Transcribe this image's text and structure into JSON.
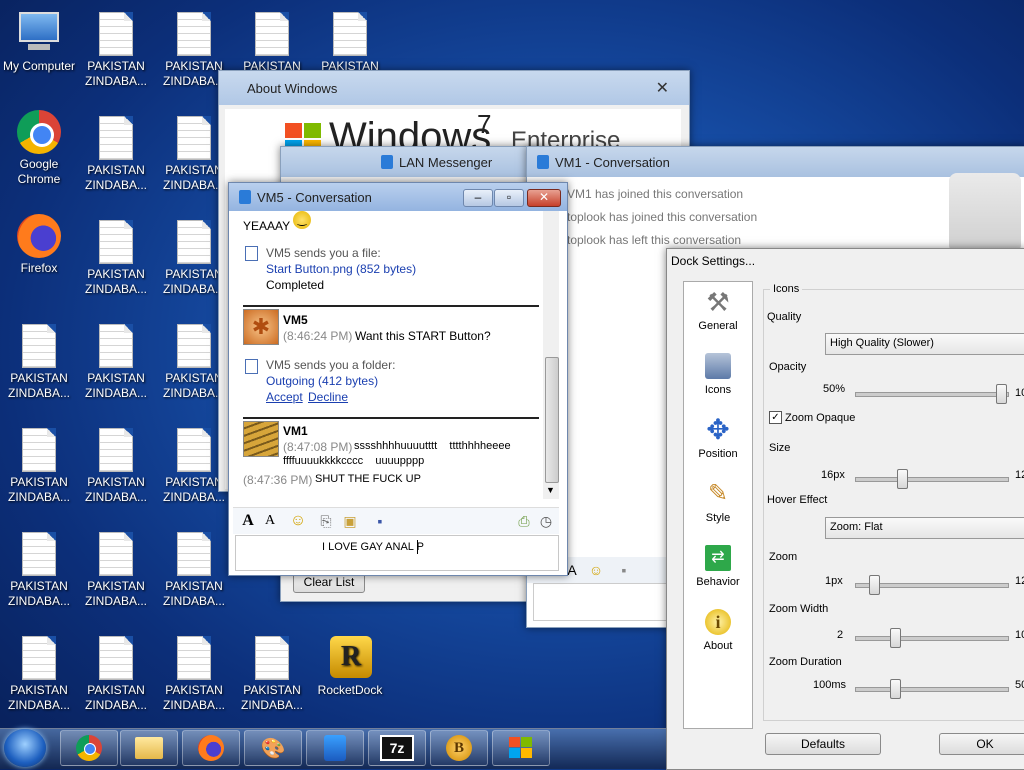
{
  "desktop": {
    "my_computer": "My Computer",
    "chrome": "Google Chrome",
    "firefox": "Firefox",
    "rocketdock": "RocketDock",
    "pak_line1": "PAKISTAN",
    "pak_line2": "ZINDABA...",
    "pak_name_visible": "PAKISTAN"
  },
  "about_windows": {
    "title": "About Windows",
    "logo_text": "Windows",
    "logo_seven": "7",
    "edition": "Enterprise"
  },
  "lan_messenger": {
    "title": "LAN Messenger",
    "clear_list": "Clear List"
  },
  "vm1_conv": {
    "title": "VM1 - Conversation",
    "lines": [
      "VM1 has joined this conversation",
      "toplook has joined this conversation",
      "toplook has left this conversation"
    ]
  },
  "vm5_conv": {
    "title": "VM5 - Conversation",
    "msg_yeaaay": "YEAAAY",
    "file_send": "VM5 sends you a file:",
    "file_name": "Start Button.png (852 bytes)",
    "file_status": "Completed",
    "vm5_name": "VM5",
    "vm5_time": "(8:46:24 PM)",
    "vm5_text": "Want this START Button?",
    "folder_send": "VM5 sends you a folder:",
    "folder_name": "Outgoing (412 bytes)",
    "accept": "Accept",
    "decline": "Decline",
    "vm1_name": "VM1",
    "vm1_time": "(8:47:08 PM)",
    "vm1_text1": "sssshhhhuuuutttt    tttthhhheeee",
    "vm1_text2": "ffffuuuukkkkcccc    uuuupppp",
    "vm1_time2": "(8:47:36 PM)",
    "vm1_text3": "SHUT THE FUCK UP",
    "input_value": "I LOVE GAY ANAL P"
  },
  "dock_settings": {
    "title": "Dock Settings...",
    "nav": [
      "General",
      "Icons",
      "Position",
      "Style",
      "Behavior",
      "About"
    ],
    "group_title": "Icons",
    "quality_label": "Quality",
    "quality_value": "High Quality (Slower)",
    "opacity_label": "Opacity",
    "opacity_value": "50%",
    "opacity_max": "10",
    "opacity_level": 1.0,
    "zoom_opaque": "Zoom Opaque",
    "size_label": "Size",
    "size_value": "16px",
    "size_max": "12",
    "size_level": 0.3,
    "hover_label": "Hover Effect",
    "hover_value": "Zoom: Flat",
    "zoom_label": "Zoom",
    "zoom_value": "1px",
    "zoom_max": "12",
    "zoom_level": 0.1,
    "zoom_width_label": "Zoom Width",
    "zoom_width_value": "2",
    "zoom_width_max": "10",
    "zoom_width_level": 0.25,
    "zoom_duration_label": "Zoom Duration",
    "zoom_duration_value": "100ms",
    "zoom_duration_max": "50",
    "zoom_duration_level": 0.25,
    "defaults": "Defaults",
    "ok": "OK"
  },
  "taskbar": {
    "icons": [
      "start-orb",
      "chrome",
      "explorer",
      "firefox",
      "paint",
      "messenger",
      "7zip",
      "bitcoin",
      "windows"
    ]
  }
}
